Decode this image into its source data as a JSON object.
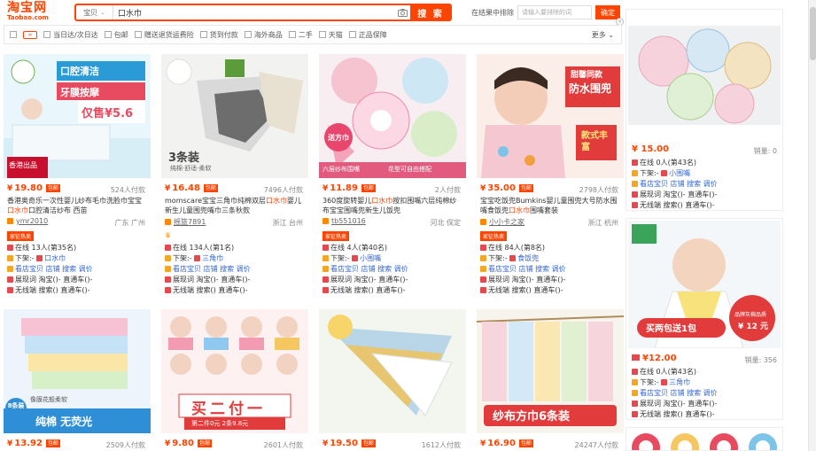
{
  "header": {
    "logo_cn": "淘宝网",
    "logo_en": "Taobao.com",
    "search_category": "宝贝",
    "search_query": "口水巾",
    "search_button": "搜 索",
    "in_result_label": "在结果中排除",
    "in_result_placeholder": "请输入要排除的词",
    "in_result_button": "确定"
  },
  "filters": {
    "items": [
      "当日达/次日达",
      "包邮",
      "赠送退货运费险",
      "货到付款",
      "海外商品",
      "二手",
      "天猫",
      "正品保障"
    ],
    "more": "更多"
  },
  "products": [
    {
      "price": "19.80",
      "baoyou": "包邮",
      "paid": "524人付款",
      "title_pre": "香港奥奇乐一次性婴儿纱布毛巾洗脸巾宝宝",
      "title_hl": "口水巾",
      "title_post": "口腔清洁纱布 西苗",
      "shop": "ymr2010",
      "location": "广东 广州",
      "hot": "家征热卖",
      "online": "在线 13人(第35名)",
      "l2": "下架",
      "l2b": "口水巾",
      "l3": "看店宝贝 店铺 搜索 调价",
      "l4": "展现词 淘宝()- 直通车()-",
      "l5": "无线端 搜索() 直通车()-",
      "pic_text1": "口腔清洁",
      "pic_text2": "牙膜按摩",
      "pic_text3": "仅售¥5.6",
      "pic_text4": "香港出品"
    },
    {
      "price": "16.48",
      "baoyou": "包邮",
      "paid": "7496人付款",
      "title_pre": "momscare宝宝三角巾纯棉双层",
      "title_hl": "口水巾",
      "title_post": "婴儿新生儿童围兜嘴巾三条秋款",
      "shop": "摇篮7891",
      "location": "浙江 台州",
      "hot": "",
      "online": "在线 134人(第1名)",
      "l2": "下架",
      "l2b": "三角巾",
      "l3": "看店宝贝 店铺 搜索 调价",
      "l4": "展现词 淘宝()- 直通车()-",
      "l5": "无线端 搜索() 直通车()-",
      "pic_text1": "3条装",
      "pic_text2": "纯棉·舒适·柔软",
      "pic_text3": "",
      "pic_text4": ""
    },
    {
      "price": "11.89",
      "baoyou": "包邮",
      "paid": "2人付款",
      "title_pre": "360度旋转婴儿",
      "title_hl": "口水巾",
      "title_post": "按扣围嘴六层纯棉纱布宝宝围嘴兜新生儿饭兜",
      "shop": "tb551016",
      "location": "河北 保定",
      "hot": "家征热卖",
      "online": "在线 4人(第40名)",
      "l2": "下架",
      "l2b": "小围嘴",
      "l3": "看店宝贝 店铺 搜索 调价",
      "l4": "展现词 淘宝()- 直通车()-",
      "l5": "无线端 搜索() 直通车()-",
      "pic_text1": "送方巾",
      "pic_text2": "六层纱布围嘴",
      "pic_text3": "花型可自由搭配",
      "pic_text4": ""
    },
    {
      "price": "35.00",
      "baoyou": "包邮",
      "paid": "2798人付款",
      "title_pre": "宝宝吃饭兜Bumkins婴儿童围兜大号防水围嘴食饭兜",
      "title_hl": "口水巾",
      "title_post": "围嘴套装",
      "shop": "小小卡之家",
      "location": "浙江 杭州",
      "hot": "家征热卖",
      "online": "在线 84人(第8名)",
      "l2": "下架",
      "l2b": "食饭兜",
      "l3": "看店宝贝 店铺 搜索 调价",
      "l4": "展现词 淘宝()- 直通车()-",
      "l5": "无线端 搜索() 直通车()-",
      "pic_text1": "甜馨同款",
      "pic_text2": "防水围兜",
      "pic_text3": "款式丰富",
      "pic_text4": ""
    },
    {
      "price": "13.92",
      "baoyou": "包邮",
      "paid": "2509人付款",
      "pic_text1": "像膜花般柔软",
      "pic_text2": "纯棉 无荧光",
      "pic_text3": "8条装",
      "pic_text4": ""
    },
    {
      "price": "9.80",
      "baoyou": "包邮",
      "paid": "2601人付款",
      "pic_text1": "买二付一",
      "pic_text2": "第二件0元 2条9.8元",
      "pic_text3": "",
      "pic_text4": ""
    },
    {
      "price": "19.50",
      "baoyou": "包邮",
      "paid": "1612人付款",
      "pic_text1": "",
      "pic_text2": "",
      "pic_text3": "",
      "pic_text4": ""
    },
    {
      "price": "16.90",
      "baoyou": "包邮",
      "paid": "24247人付款",
      "pic_text1": "纱布方巾6条装",
      "pic_text2": "",
      "pic_text3": "",
      "pic_text4": ""
    }
  ],
  "sidebar": {
    "ads": [
      {
        "price": "15.00",
        "sales": "销量: 0",
        "online": "在线 0人(第43名)",
        "l2": "下架",
        "l2b": "小围嘴",
        "l3": "看店宝贝 店铺 搜索 调价",
        "l4": "展现词 淘宝()- 直通车()-",
        "l5": "无线端 搜索() 直通车()-"
      },
      {
        "price": "12.00",
        "sales": "销量: 356",
        "online": "在线 0人(第43名)",
        "l2": "下架",
        "l2b": "三角巾",
        "l3": "看店宝贝 店铺 搜索 调价",
        "l4": "展现词 淘宝()- 直通车()-",
        "l5": "无线端 搜索() 直通车()-",
        "pic_text1": "买两包送1包",
        "pic_text2": "品牌灰棉品质",
        "pic_text3": "¥ 12 元"
      }
    ]
  },
  "labels": {
    "currency": "¥",
    "shop_mark": "◆"
  },
  "colors": {
    "accent": "#ff4400",
    "link": "#3366cc"
  }
}
